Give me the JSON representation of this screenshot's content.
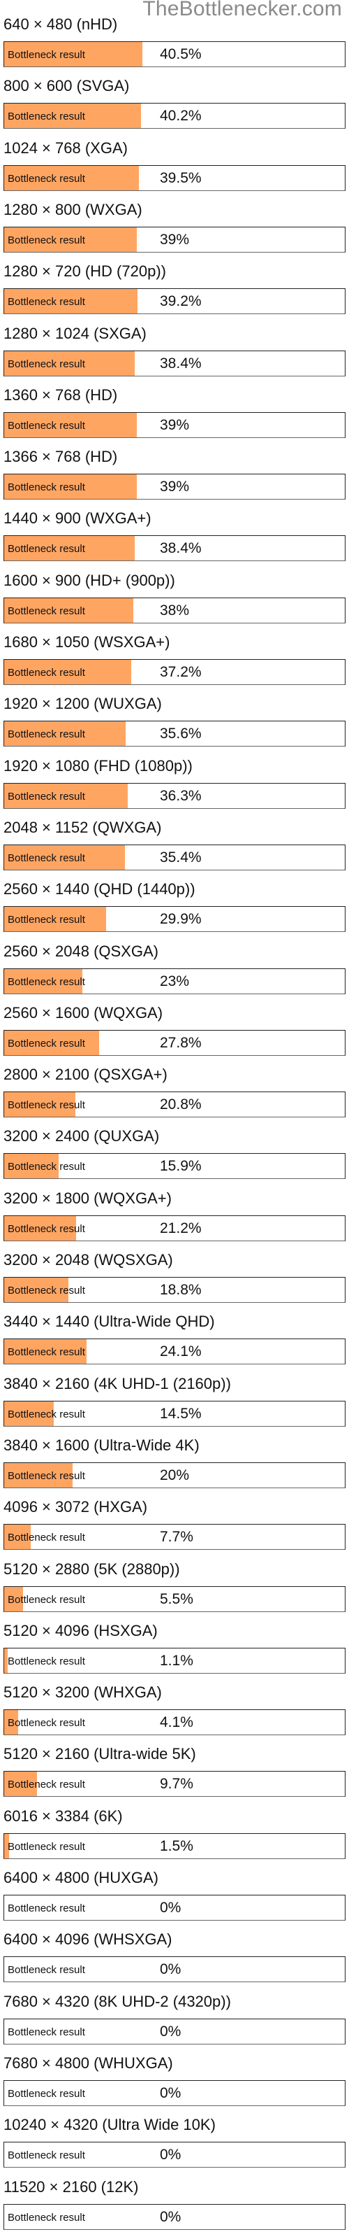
{
  "site": {
    "watermark": "TheBottlenecker.com"
  },
  "bar_label": "Bottleneck result",
  "fill_color": "#FFA562",
  "chart_data": {
    "type": "bar",
    "orientation": "horizontal",
    "title": "",
    "xlim": [
      0,
      100
    ],
    "unit": "%",
    "rows": [
      {
        "resolution": "640 × 480 (nHD)",
        "value": 40.5,
        "value_text": "40.5%"
      },
      {
        "resolution": "800 × 600 (SVGA)",
        "value": 40.2,
        "value_text": "40.2%"
      },
      {
        "resolution": "1024 × 768 (XGA)",
        "value": 39.5,
        "value_text": "39.5%"
      },
      {
        "resolution": "1280 × 800 (WXGA)",
        "value": 39,
        "value_text": "39%"
      },
      {
        "resolution": "1280 × 720 (HD (720p))",
        "value": 39.2,
        "value_text": "39.2%"
      },
      {
        "resolution": "1280 × 1024 (SXGA)",
        "value": 38.4,
        "value_text": "38.4%"
      },
      {
        "resolution": "1360 × 768 (HD)",
        "value": 39,
        "value_text": "39%"
      },
      {
        "resolution": "1366 × 768 (HD)",
        "value": 39,
        "value_text": "39%"
      },
      {
        "resolution": "1440 × 900 (WXGA+)",
        "value": 38.4,
        "value_text": "38.4%"
      },
      {
        "resolution": "1600 × 900 (HD+ (900p))",
        "value": 38,
        "value_text": "38%"
      },
      {
        "resolution": "1680 × 1050 (WSXGA+)",
        "value": 37.2,
        "value_text": "37.2%"
      },
      {
        "resolution": "1920 × 1200 (WUXGA)",
        "value": 35.6,
        "value_text": "35.6%"
      },
      {
        "resolution": "1920 × 1080 (FHD (1080p))",
        "value": 36.3,
        "value_text": "36.3%"
      },
      {
        "resolution": "2048 × 1152 (QWXGA)",
        "value": 35.4,
        "value_text": "35.4%"
      },
      {
        "resolution": "2560 × 1440 (QHD (1440p))",
        "value": 29.9,
        "value_text": "29.9%"
      },
      {
        "resolution": "2560 × 2048 (QSXGA)",
        "value": 23,
        "value_text": "23%"
      },
      {
        "resolution": "2560 × 1600 (WQXGA)",
        "value": 27.8,
        "value_text": "27.8%"
      },
      {
        "resolution": "2800 × 2100 (QSXGA+)",
        "value": 20.8,
        "value_text": "20.8%"
      },
      {
        "resolution": "3200 × 2400 (QUXGA)",
        "value": 15.9,
        "value_text": "15.9%"
      },
      {
        "resolution": "3200 × 1800 (WQXGA+)",
        "value": 21.2,
        "value_text": "21.2%"
      },
      {
        "resolution": "3200 × 2048 (WQSXGA)",
        "value": 18.8,
        "value_text": "18.8%"
      },
      {
        "resolution": "3440 × 1440 (Ultra-Wide QHD)",
        "value": 24.1,
        "value_text": "24.1%"
      },
      {
        "resolution": "3840 × 2160 (4K UHD-1 (2160p))",
        "value": 14.5,
        "value_text": "14.5%"
      },
      {
        "resolution": "3840 × 1600 (Ultra-Wide 4K)",
        "value": 20,
        "value_text": "20%"
      },
      {
        "resolution": "4096 × 3072 (HXGA)",
        "value": 7.7,
        "value_text": "7.7%"
      },
      {
        "resolution": "5120 × 2880 (5K (2880p))",
        "value": 5.5,
        "value_text": "5.5%"
      },
      {
        "resolution": "5120 × 4096 (HSXGA)",
        "value": 1.1,
        "value_text": "1.1%"
      },
      {
        "resolution": "5120 × 3200 (WHXGA)",
        "value": 4.1,
        "value_text": "4.1%"
      },
      {
        "resolution": "5120 × 2160 (Ultra-wide 5K)",
        "value": 9.7,
        "value_text": "9.7%"
      },
      {
        "resolution": "6016 × 3384 (6K)",
        "value": 1.5,
        "value_text": "1.5%"
      },
      {
        "resolution": "6400 × 4800 (HUXGA)",
        "value": 0,
        "value_text": "0%"
      },
      {
        "resolution": "6400 × 4096 (WHSXGA)",
        "value": 0,
        "value_text": "0%"
      },
      {
        "resolution": "7680 × 4320 (8K UHD-2 (4320p))",
        "value": 0,
        "value_text": "0%"
      },
      {
        "resolution": "7680 × 4800 (WHUXGA)",
        "value": 0,
        "value_text": "0%"
      },
      {
        "resolution": "10240 × 4320 (Ultra Wide 10K)",
        "value": 0,
        "value_text": "0%"
      },
      {
        "resolution": "11520 × 2160 (12K)",
        "value": 0,
        "value_text": "0%"
      }
    ]
  }
}
